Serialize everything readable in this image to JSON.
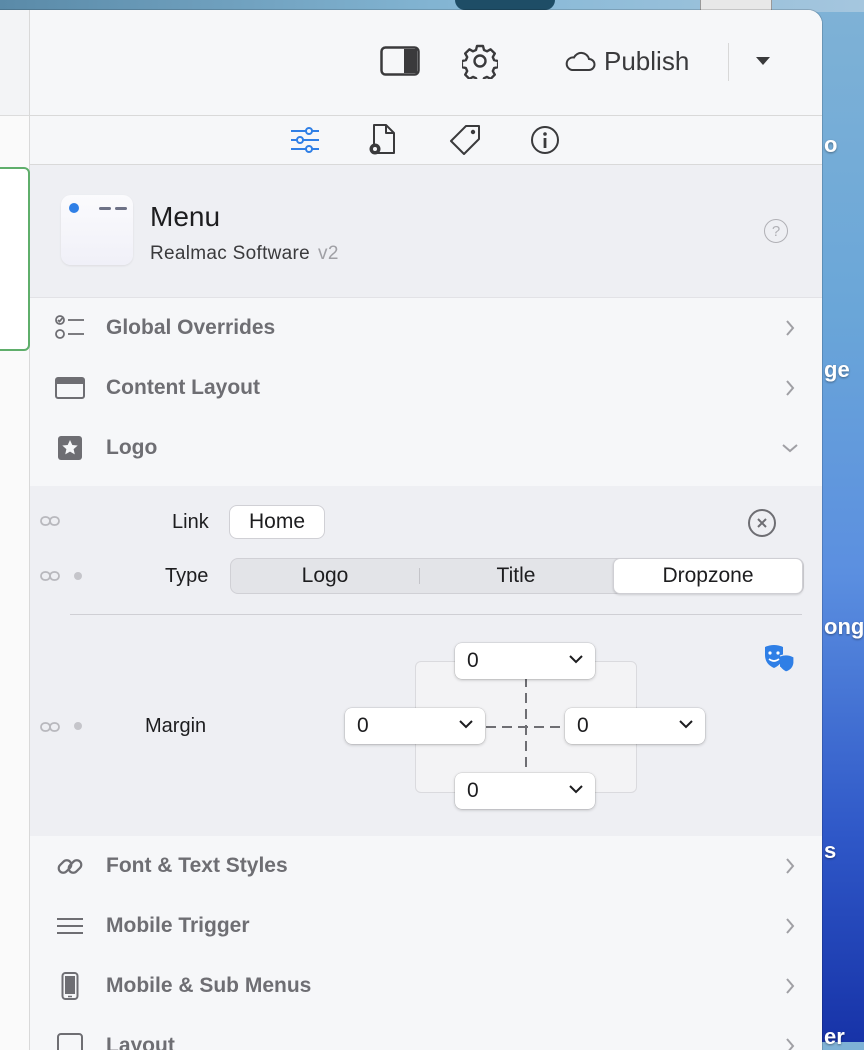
{
  "toolbar": {
    "publish_label": "Publish",
    "icons": [
      "sidebar-toggle-icon",
      "gear-icon",
      "cloud-icon",
      "chevron-down-icon"
    ]
  },
  "tabs": [
    "sliders-icon",
    "document-settings-icon",
    "tag-icon",
    "info-icon"
  ],
  "header": {
    "title": "Menu",
    "vendor": "Realmac Software",
    "version": "v2",
    "help": "?"
  },
  "sections": {
    "global_overrides": "Global Overrides",
    "content_layout": "Content Layout",
    "logo": "Logo",
    "font_text_styles": "Font & Text Styles",
    "mobile_trigger": "Mobile Trigger",
    "mobile_sub_menus": "Mobile & Sub Menus",
    "layout": "Layout"
  },
  "logo": {
    "link_label": "Link",
    "link_value": "Home",
    "type_label": "Type",
    "type_options": [
      "Logo",
      "Title",
      "Dropzone"
    ],
    "type_selected": "Dropzone",
    "margin_label": "Margin",
    "margin": {
      "top": "0",
      "left": "0",
      "right": "0",
      "bottom": "0"
    }
  },
  "desktop": {
    "labels": [
      "o",
      "ge",
      "ong",
      "s",
      "er"
    ]
  },
  "colors": {
    "accent": "#2f7fe6",
    "selected_border": "#5fae6b",
    "section_label": "#6e6e73"
  }
}
